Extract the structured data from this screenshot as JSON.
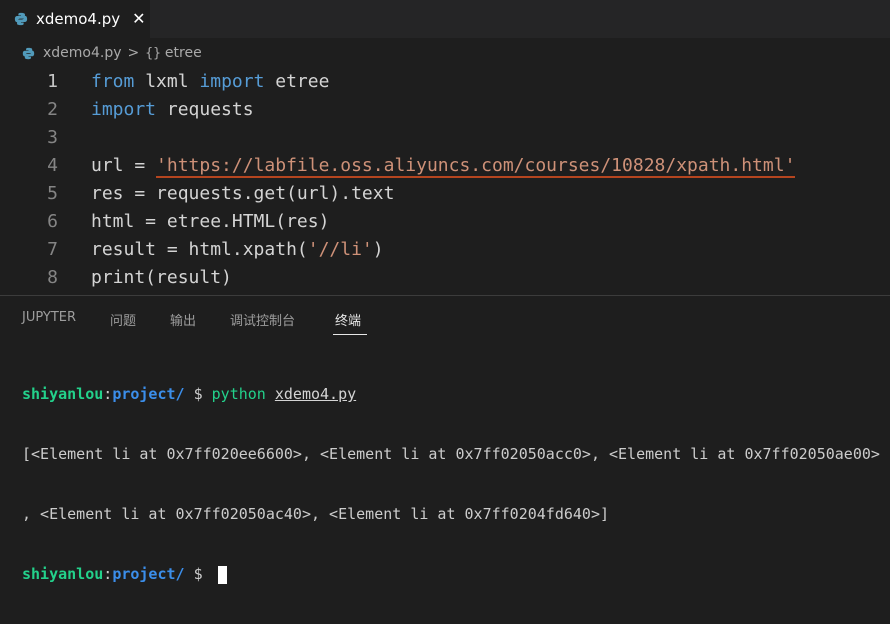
{
  "tab": {
    "filename": "xdemo4.py",
    "close_glyph": "✕"
  },
  "breadcrumb": {
    "file": "xdemo4.py",
    "separator": ">",
    "symbol_icon": "{}",
    "symbol": "etree"
  },
  "editor": {
    "lines": [
      {
        "num": "1",
        "tokens": [
          [
            "kw",
            "from"
          ],
          [
            "",
            "  lxml "
          ],
          [
            "kw",
            "import"
          ],
          [
            "",
            " etree"
          ]
        ]
      },
      {
        "num": "2",
        "tokens": [
          [
            "kw",
            "import"
          ],
          [
            "",
            " requests"
          ]
        ]
      },
      {
        "num": "3",
        "tokens": []
      },
      {
        "num": "4",
        "tokens": [
          [
            "",
            "url = "
          ],
          [
            "str",
            "'https://labfile.oss.aliyuncs.com/courses/10828/xpath.html'"
          ]
        ]
      },
      {
        "num": "5",
        "tokens": [
          [
            "",
            "res = requests.get(url).text"
          ]
        ]
      },
      {
        "num": "6",
        "tokens": [
          [
            "",
            "html = etree.HTML(res)"
          ]
        ]
      },
      {
        "num": "7",
        "tokens": [
          [
            "",
            "result = html.xpath("
          ],
          [
            "str",
            "'//li'"
          ],
          [
            "",
            ")"
          ]
        ]
      },
      {
        "num": "8",
        "tokens": [
          [
            "",
            "print(result)"
          ]
        ]
      }
    ]
  },
  "panel": {
    "tabs": [
      "JUPYTER",
      "问题",
      "输出",
      "调试控制台",
      "终端"
    ],
    "active_tab": "终端"
  },
  "terminal": {
    "user": "shiyanlou",
    "colon": ":",
    "path": "project/",
    "prompt": " $ ",
    "command": "python",
    "command_arg": "xdemo4.py",
    "output_line1": "[<Element li at 0x7ff020ee6600>, <Element li at 0x7ff02050acc0>, <Element li at 0x7ff02050ae00>",
    "output_line2": ", <Element li at 0x7ff02050ac40>, <Element li at 0x7ff0204fd640>]"
  },
  "colors": {
    "keyword": "#569cd6",
    "string": "#ce9178",
    "user": "#23d18b",
    "path": "#3b8eea"
  },
  "icons": {
    "file_icon": "python-icon",
    "close_icon": "close-icon",
    "symbol_icon": "braces-icon"
  }
}
